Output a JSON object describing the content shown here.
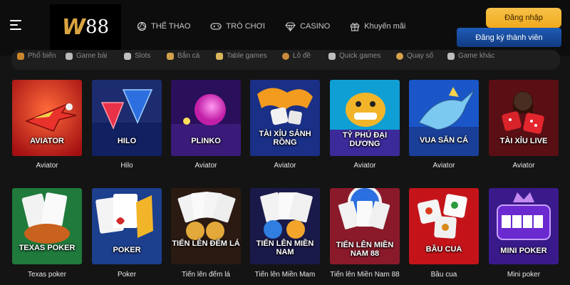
{
  "header": {
    "logo": {
      "w": "W",
      "digits": "88"
    },
    "nav": [
      {
        "label": "THỂ THAO",
        "icon": "volleyball-icon"
      },
      {
        "label": "TRÒ CHƠI",
        "icon": "gamepad-icon"
      },
      {
        "label": "CASINO",
        "icon": "diamond-icon"
      },
      {
        "label": "Khuyến mãi",
        "icon": "gift-icon"
      }
    ],
    "login_label": "Đăng nhập",
    "register_label": "Đăng ký thành viên"
  },
  "categories": [
    "Phổ biến",
    "Game bài",
    "Slots",
    "Bắn cá",
    "Table games",
    "Lô đề",
    "Quick games",
    "Quay số",
    "Game khác"
  ],
  "games": [
    {
      "title": "AVIATOR",
      "caption": "Aviator"
    },
    {
      "title": "HILO",
      "caption": "Hilo"
    },
    {
      "title": "PLINKO",
      "caption": "Aviator"
    },
    {
      "title": "TÀI XỈU SẢNH RỒNG",
      "caption": "Aviator"
    },
    {
      "title": "TỶ PHÚ ĐẠI DƯƠNG",
      "caption": "Aviator"
    },
    {
      "title": "VUA SĂN CÁ",
      "caption": "Aviator"
    },
    {
      "title": "TÀI XỈU LIVE",
      "caption": "Aviator"
    },
    {
      "title": "TEXAS POKER",
      "caption": "Texas poker"
    },
    {
      "title": "POKER",
      "caption": "Poker"
    },
    {
      "title": "TIẾN LÊN ĐẾM LÁ",
      "caption": "Tiến lên đếm lá"
    },
    {
      "title": "TIẾN LÊN MIỀN NAM",
      "caption": "Tiến lên Miền Mam"
    },
    {
      "title": "TIẾN LÊN MIỀN NAM 88",
      "caption": "Tiến lên Miền Nam 88"
    },
    {
      "title": "BẦU CUA",
      "caption": "Bầu cua"
    },
    {
      "title": "MINI POKER",
      "caption": "Mini poker"
    }
  ],
  "colors": {
    "login": "#f0a91d",
    "register": "#1e4fa0",
    "logo_gold": "#d9a441",
    "background": "#141414"
  }
}
